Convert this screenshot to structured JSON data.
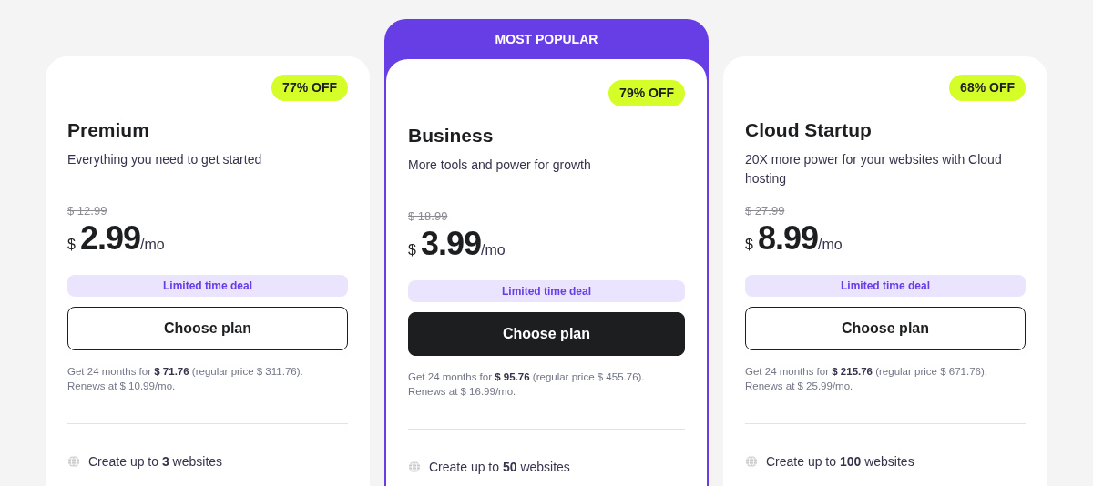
{
  "plans": [
    {
      "name": "Premium",
      "featured": false,
      "discount": "77% OFF",
      "description": "Everything you need to get started",
      "old_price": "$ 12.99",
      "currency": "$",
      "price": "2.99",
      "period": "/mo",
      "deal": "Limited time deal",
      "button": "Choose plan",
      "note": [
        "Get 24 months for **$ 71.76** (regular price $ 311.76).",
        "Renews at $ 10.99/mo."
      ],
      "features": [
        "Create up to **3** websites"
      ]
    },
    {
      "name": "Business",
      "featured": true,
      "ribbon": "MOST POPULAR",
      "discount": "79% OFF",
      "description": "More tools and power for growth",
      "old_price": "$ 18.99",
      "currency": "$",
      "price": "3.99",
      "period": "/mo",
      "deal": "Limited time deal",
      "button": "Choose plan",
      "note": [
        "Get 24 months for **$ 95.76** (regular price $ 455.76).",
        "Renews at $ 16.99/mo."
      ],
      "features": [
        "Create up to **50** websites"
      ]
    },
    {
      "name": "Cloud Startup",
      "featured": false,
      "discount": "68% OFF",
      "description": "20X more power for your websites with Cloud hosting",
      "old_price": "$ 27.99",
      "currency": "$",
      "price": "8.99",
      "period": "/mo",
      "deal": "Limited time deal",
      "button": "Choose plan",
      "note": [
        "Get 24 months for **$ 215.76** (regular price $ 671.76).",
        "Renews at $ 25.99/mo."
      ],
      "features": [
        "Create up to **100** websites"
      ]
    }
  ]
}
